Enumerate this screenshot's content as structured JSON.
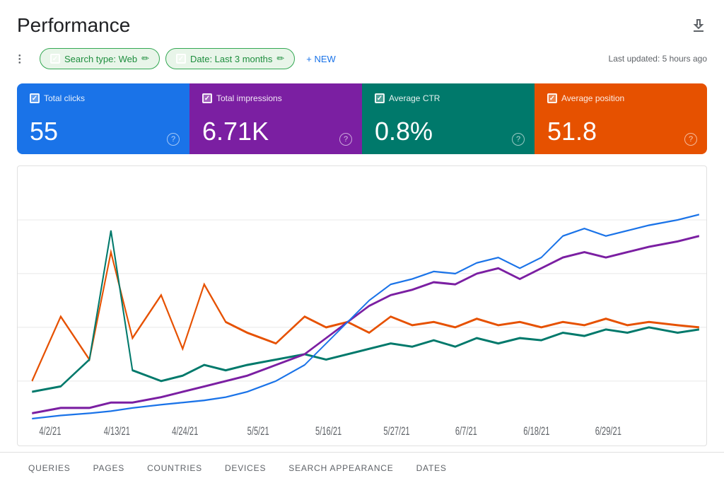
{
  "header": {
    "title": "Performance",
    "last_updated": "Last updated: 5 hours ago"
  },
  "filters": {
    "search_type_label": "Search type: Web",
    "date_label": "Date: Last 3 months",
    "new_button": "+ NEW"
  },
  "metrics": [
    {
      "id": "clicks",
      "label": "Total clicks",
      "value": "55",
      "color_class": "metric-card-clicks"
    },
    {
      "id": "impressions",
      "label": "Total impressions",
      "value": "6.71K",
      "color_class": "metric-card-impressions"
    },
    {
      "id": "ctr",
      "label": "Average CTR",
      "value": "0.8%",
      "color_class": "metric-card-ctr"
    },
    {
      "id": "position",
      "label": "Average position",
      "value": "51.8",
      "color_class": "metric-card-position"
    }
  ],
  "chart": {
    "x_labels": [
      "4/2/21",
      "4/13/21",
      "4/24/21",
      "5/5/21",
      "5/16/21",
      "5/27/21",
      "6/7/21",
      "6/18/21",
      "6/29/21"
    ],
    "series": {
      "clicks_color": "#1a73e8",
      "impressions_color": "#7b1fa2",
      "ctr_color": "#00796b",
      "position_color": "#e65100"
    }
  },
  "bottom_tabs": [
    {
      "label": "QUERIES"
    },
    {
      "label": "PAGES"
    },
    {
      "label": "COUNTRIES"
    },
    {
      "label": "DEVICES"
    },
    {
      "label": "SEARCH APPEARANCE"
    },
    {
      "label": "DATES"
    }
  ]
}
